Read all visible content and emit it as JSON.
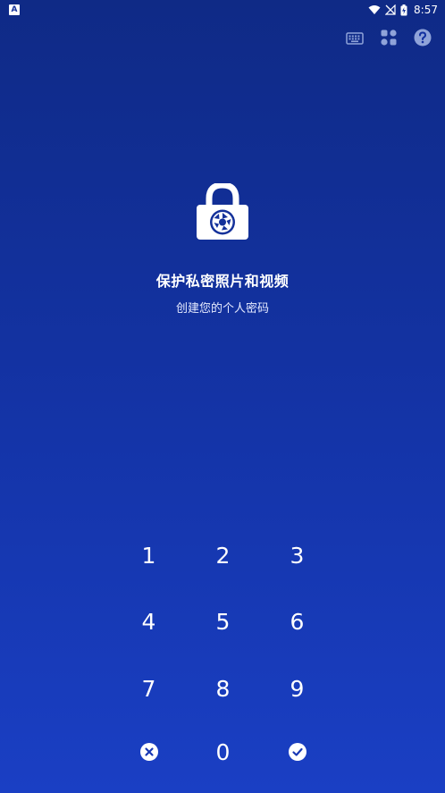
{
  "status_bar": {
    "badge": "A",
    "time": "8:57"
  },
  "toolbar": {
    "icons": [
      "keyboard-icon",
      "shuffle-icon",
      "help-icon"
    ]
  },
  "hero": {
    "title": "保护私密照片和视频",
    "subtitle": "创建您的个人密码"
  },
  "keypad": {
    "keys": [
      "1",
      "2",
      "3",
      "4",
      "5",
      "6",
      "7",
      "8",
      "9",
      "0"
    ],
    "clear_icon": "clear-icon",
    "confirm_icon": "check-icon"
  },
  "colors": {
    "background_top": "#0f2a86",
    "background_bottom": "#1a3fc4",
    "foreground": "#ffffff"
  }
}
